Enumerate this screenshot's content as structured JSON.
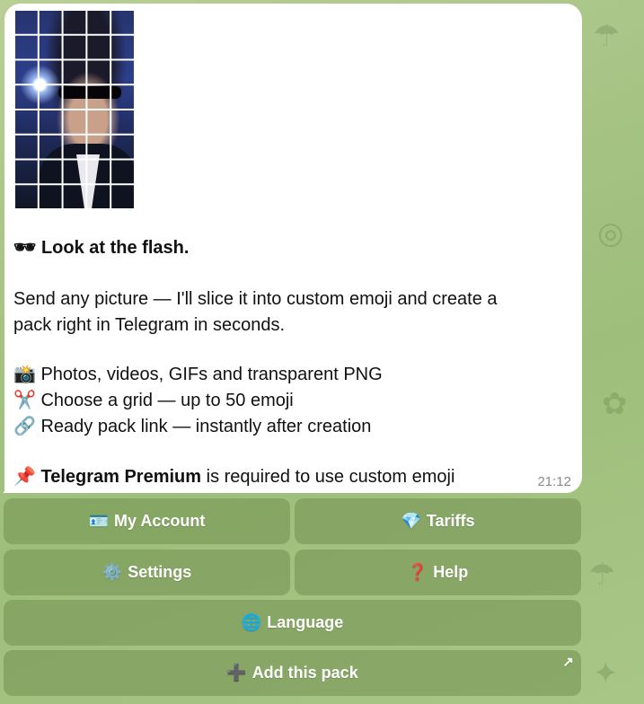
{
  "message": {
    "headline_emoji": "🕶",
    "headline": "Look at the flash.",
    "intro_line1": "Send any picture — I'll slice it into custom emoji and create a",
    "intro_line2": "pack right in Telegram in seconds.",
    "features": [
      {
        "emoji": "📸",
        "text": "Photos, videos, GIFs and transparent PNG"
      },
      {
        "emoji": "✂️",
        "text": "Choose a grid — up to 50 emoji"
      },
      {
        "emoji": "🔗",
        "text": "Ready pack link — instantly after creation"
      }
    ],
    "premium_emoji": "📌",
    "premium_bold": "Telegram Premium",
    "premium_rest": " is required to use custom emoji",
    "time": "21:12"
  },
  "keyboard": {
    "my_account": {
      "icon": "🪪",
      "label": "My Account"
    },
    "tariffs": {
      "icon": "💎",
      "label": "Tariffs"
    },
    "settings": {
      "icon": "⚙️",
      "label": "Settings"
    },
    "help": {
      "icon": "❓",
      "label": "Help"
    },
    "language": {
      "icon": "🌐",
      "label": "Language"
    },
    "add_pack": {
      "icon": "➕",
      "label": "Add this pack",
      "corner_icon": "↗"
    }
  },
  "colors": {
    "bubble": "#ffffff",
    "button_bg": "#7f9958",
    "wallpaper": "#a6c384"
  }
}
